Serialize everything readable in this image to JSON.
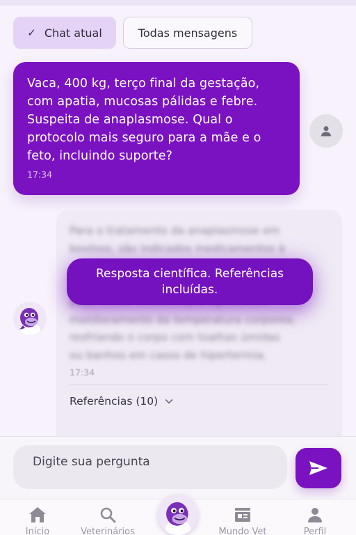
{
  "filters": {
    "active_label": "Chat atual",
    "other_label": "Todas mensagens"
  },
  "user_message": {
    "text": "Vaca, 400 kg, terço final da gestação, com apatia, mucosas pálidas e febre. Suspeita de anaplasmose. Qual o protocolo mais seguro para a mãe e o feto, incluindo suporte?",
    "time": "17:34"
  },
  "bot_message": {
    "blurred_lines": [
      "Para o tratamento da anaplasmose em",
      "bovinos, são indicados medicamentos à",
      "",
      "",
      "pode incluir fluidoterapia agressiva e",
      "monitoramento da temperatura corporea,",
      "resfriando o corpo com toalhas úmidas",
      "ou banhos em casos de hipertermia."
    ],
    "time": "17:34",
    "references_label": "Referências (10)"
  },
  "notice": {
    "text": "Resposta científica. Referências incluídas."
  },
  "composer": {
    "placeholder": "Digite sua pergunta"
  },
  "nav": {
    "items": [
      {
        "label": "Início",
        "icon": "home-icon"
      },
      {
        "label": "Veterinários",
        "icon": "search-icon"
      },
      {
        "label": "Mundo Vet",
        "icon": "news-icon"
      },
      {
        "label": "Perfil",
        "icon": "person-icon"
      }
    ]
  },
  "colors": {
    "accent": "#7b12c2",
    "chip_active": "#e5d3f7",
    "background": "#f7f2fb"
  }
}
